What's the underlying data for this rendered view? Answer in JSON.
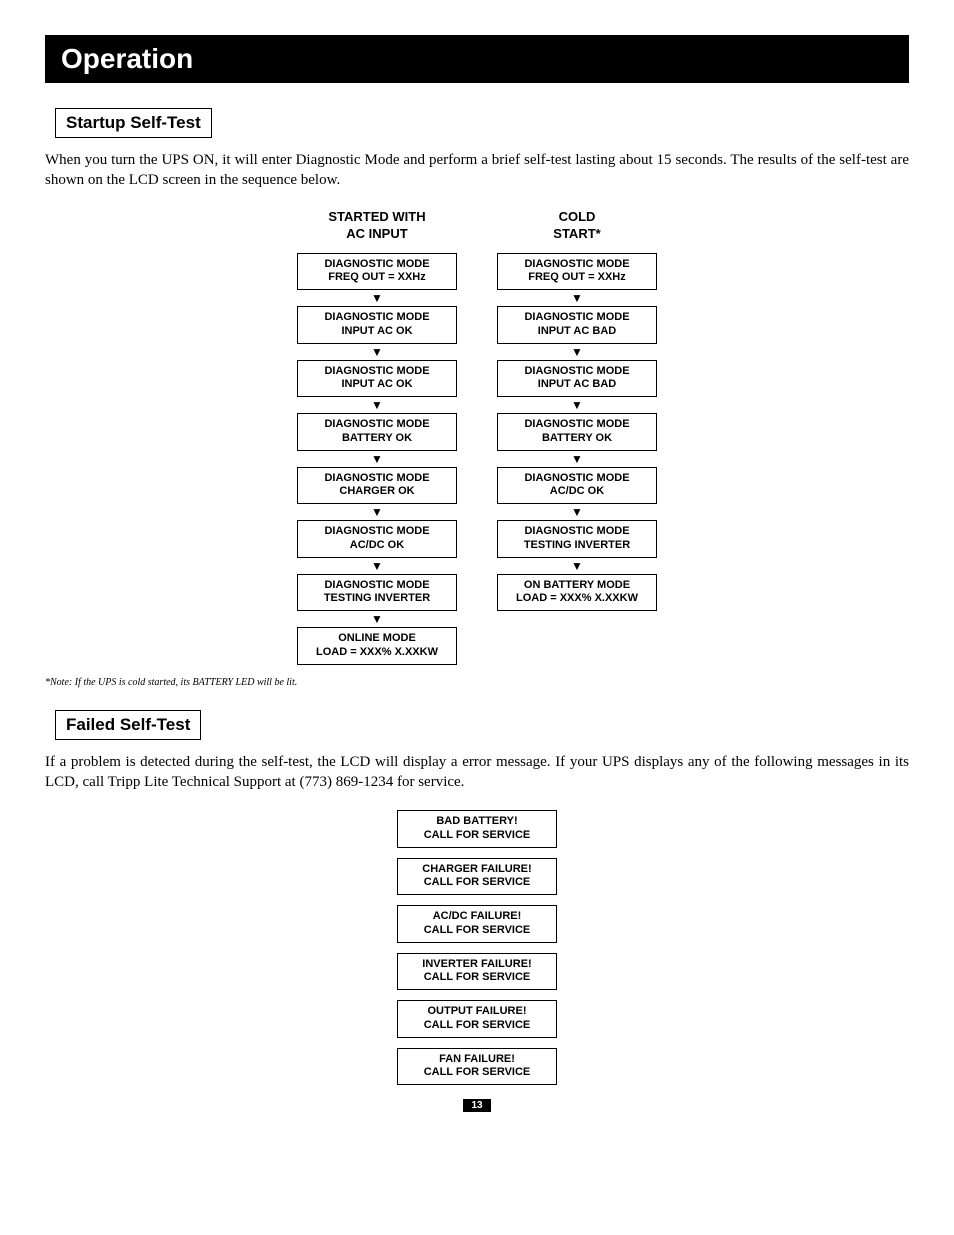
{
  "banner": "Operation",
  "section1": {
    "title": "Startup Self-Test",
    "para": "When you turn the UPS ON, it will enter Diagnostic Mode and perform a brief self-test lasting about 15 seconds. The results of the self-test are shown on the LCD screen in the sequence below.",
    "col1_head": "STARTED WITH\nAC INPUT",
    "col2_head": "COLD\nSTART*",
    "col1_steps": [
      {
        "l1": "DIAGNOSTIC MODE",
        "l2": "FREQ OUT = XXHz"
      },
      {
        "l1": "DIAGNOSTIC MODE",
        "l2": "INPUT AC OK"
      },
      {
        "l1": "DIAGNOSTIC MODE",
        "l2": "INPUT AC OK"
      },
      {
        "l1": "DIAGNOSTIC MODE",
        "l2": "BATTERY OK"
      },
      {
        "l1": "DIAGNOSTIC MODE",
        "l2": "CHARGER OK"
      },
      {
        "l1": "DIAGNOSTIC MODE",
        "l2": "AC/DC OK"
      },
      {
        "l1": "DIAGNOSTIC MODE",
        "l2": "TESTING INVERTER"
      },
      {
        "l1": "ONLINE MODE",
        "l2": "LOAD = XXX% X.XXKW"
      }
    ],
    "col2_steps": [
      {
        "l1": "DIAGNOSTIC MODE",
        "l2": "FREQ OUT = XXHz"
      },
      {
        "l1": "DIAGNOSTIC MODE",
        "l2": "INPUT AC BAD"
      },
      {
        "l1": "DIAGNOSTIC MODE",
        "l2": "INPUT AC BAD"
      },
      {
        "l1": "DIAGNOSTIC MODE",
        "l2": "BATTERY OK"
      },
      {
        "l1": "DIAGNOSTIC MODE",
        "l2": "AC/DC OK"
      },
      {
        "l1": "DIAGNOSTIC MODE",
        "l2": "TESTING INVERTER"
      },
      {
        "l1": "ON BATTERY MODE",
        "l2": "LOAD = XXX% X.XXKW"
      }
    ],
    "note": "*Note: If the UPS is cold started, its BATTERY LED will be lit."
  },
  "section2": {
    "title": "Failed Self-Test",
    "para": "If a problem is detected during the self-test, the LCD will display a error message. If your UPS displays any of the following messages in its LCD, call Tripp Lite Technical Support at (773) 869-1234 for service.",
    "messages": [
      {
        "l1": "BAD BATTERY!",
        "l2": "CALL FOR SERVICE"
      },
      {
        "l1": "CHARGER FAILURE!",
        "l2": "CALL FOR SERVICE"
      },
      {
        "l1": "AC/DC FAILURE!",
        "l2": "CALL FOR SERVICE"
      },
      {
        "l1": "INVERTER FAILURE!",
        "l2": "CALL FOR SERVICE"
      },
      {
        "l1": "OUTPUT FAILURE!",
        "l2": "CALL FOR SERVICE"
      },
      {
        "l1": "FAN FAILURE!",
        "l2": "CALL FOR SERVICE"
      }
    ]
  },
  "page_number": "13"
}
